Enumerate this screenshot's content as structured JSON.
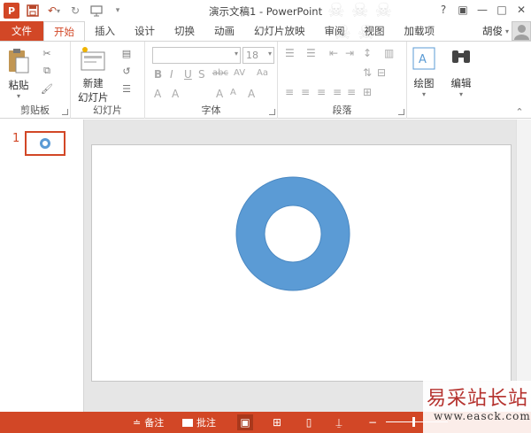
{
  "app": {
    "title": "演示文稿1 - PowerPoint",
    "logo_letter": "P",
    "accent_color": "#d24726",
    "shape_color": "#5b9bd5"
  },
  "qat": {
    "save_icon": "save-icon",
    "undo_icon": "undo-icon",
    "redo_icon": "redo-icon",
    "present_icon": "present-icon",
    "customize_icon": "customize-icon"
  },
  "window": {
    "help": "?",
    "ribbon_opts": "▣",
    "minimize": "—",
    "maximize": "□",
    "close": "✕"
  },
  "tabs": [
    {
      "label": "文件"
    },
    {
      "label": "开始"
    },
    {
      "label": "插入"
    },
    {
      "label": "设计"
    },
    {
      "label": "切换"
    },
    {
      "label": "动画"
    },
    {
      "label": "幻灯片放映"
    },
    {
      "label": "审阅"
    },
    {
      "label": "视图"
    },
    {
      "label": "加载项"
    }
  ],
  "user": {
    "name": "胡俊"
  },
  "ribbon": {
    "clipboard": {
      "label": "剪贴板",
      "paste": "粘贴"
    },
    "slides": {
      "label": "幻灯片",
      "new_slide_1": "新建",
      "new_slide_2": "幻灯片"
    },
    "font": {
      "label": "字体",
      "font_name": "",
      "font_size": "18"
    },
    "paragraph": {
      "label": "段落"
    },
    "drawing": {
      "label": "绘图"
    },
    "editing": {
      "label": "编辑"
    }
  },
  "thumbnail": {
    "number": "1"
  },
  "status": {
    "notes": "备注",
    "comments": "批注"
  },
  "watermark": {
    "title": "易采站长站",
    "url": "www.easck.com"
  }
}
